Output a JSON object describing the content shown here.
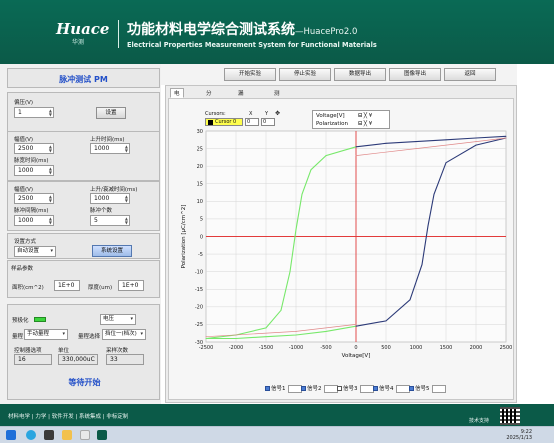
{
  "header": {
    "logo_text": "Huace",
    "logo_sub": "华测",
    "title_cn": "功能材料电学综合测试系统",
    "title_version": "—HuacePro2.0",
    "title_en": "Electrical Properties Measurement System for Functional Materials"
  },
  "left": {
    "pm_title": "脉冲测试 PM",
    "bias": {
      "label": "偏压(V)",
      "value": "1",
      "button": "设置"
    },
    "pulse1": {
      "amp_label": "幅值(V)",
      "amp_value": "2500",
      "rise_label": "上升时间(ms)",
      "rise_value": "1000",
      "width_label": "脉宽时间(ms)",
      "width_value": "1000"
    },
    "pulse2": {
      "amp_label": "幅值(V)",
      "amp_value": "2500",
      "rise_label": "上升/衰减时间(ms)",
      "rise_value": "1000",
      "interval_label": "脉冲间隔(ms)",
      "interval_value": "1000",
      "count_label": "脉冲个数",
      "count_value": "5"
    },
    "mode": {
      "label": "设置方式",
      "value": "自动设置",
      "button": "系统设置"
    },
    "sample": {
      "label": "样品参数",
      "area_label": "面积(cm^2)",
      "area_value": "1E+0",
      "thickness_label": "厚度(um)",
      "thickness_value": "1E+0"
    },
    "status": {
      "led_label": "预极化",
      "led_color": "#3cd43c",
      "volt_select": "电压",
      "range_label": "量程",
      "range_value": "手动量程",
      "range2_label": "量程选择",
      "range2_value": "挡位一(档次)",
      "ctrl_label": "控制器选项",
      "ctrl_value": "16",
      "unit_label": "单位",
      "unit_value": "330,000uC",
      "sample_count_label": "采样次数",
      "sample_count_value": "33",
      "wait": "等待开始"
    }
  },
  "toolbar": {
    "buttons": [
      "开始实验",
      "停止实验",
      "数据导出",
      "图像导出",
      "返回"
    ]
  },
  "tabs": [
    "电滞回线",
    "分数曲线",
    "漏电与极化",
    "测量结果"
  ],
  "cursor": {
    "title": "Cursors:",
    "col_x": "X",
    "col_y": "Y",
    "name": "Cursor 0",
    "x": "0",
    "y": "0"
  },
  "legend": {
    "row1": "Voltage[V]",
    "row2": "Polarization"
  },
  "channels": [
    "信号1",
    "信号2",
    "信号3",
    "信号4",
    "信号5"
  ],
  "bottom": {
    "left_text": "材料电学 | 力学 | 软件开发 | 系统集成 | 非标定制",
    "contact": "技术支持",
    "time": "9:22",
    "date": "2025/1/13"
  },
  "chart_data": {
    "type": "line",
    "title": "",
    "xlabel": "Voltage[V]",
    "ylabel": "Polarization [μC/cm^2]",
    "xlim": [
      -2500,
      2500
    ],
    "ylim": [
      -30,
      30
    ],
    "x_ticks": [
      -2500,
      -2000,
      -1500,
      -1000,
      -500,
      0,
      500,
      1000,
      1500,
      2000,
      2500
    ],
    "y_ticks": [
      -30,
      -25,
      -20,
      -15,
      -10,
      -5,
      0,
      5,
      10,
      15,
      20,
      25,
      30
    ],
    "grid": true,
    "series": [
      {
        "color": "#77e86a",
        "x": [
          -2500,
          -2000,
          -1500,
          -1250,
          -1100,
          -1000,
          -900,
          -750,
          -500,
          0
        ],
        "y": [
          -29,
          -28,
          -26,
          -21,
          -10,
          2,
          12,
          19,
          23,
          25.5
        ]
      },
      {
        "color": "#77e86a",
        "x": [
          -2500,
          -2000,
          -1500,
          -1000,
          -500,
          0
        ],
        "y": [
          -29,
          -29,
          -28.5,
          -28,
          -27,
          -25.5
        ]
      },
      {
        "color": "#2c3a78",
        "x": [
          0,
          500,
          900,
          1100,
          1200,
          1300,
          1500,
          2000,
          2500
        ],
        "y": [
          -25.5,
          -24,
          -18,
          -8,
          3,
          12,
          21,
          26,
          28
        ]
      },
      {
        "color": "#2c3a78",
        "x": [
          0,
          500,
          1000,
          1500,
          2000,
          2500
        ],
        "y": [
          25.5,
          26.5,
          27,
          27.5,
          28,
          28.5
        ]
      },
      {
        "color": "#e08888",
        "x": [
          0,
          1000,
          2000,
          2500
        ],
        "y": [
          23,
          25,
          27,
          28
        ]
      },
      {
        "color": "#e08888",
        "x": [
          -2500,
          -1000,
          0
        ],
        "y": [
          -28.5,
          -27,
          -25
        ]
      }
    ]
  }
}
